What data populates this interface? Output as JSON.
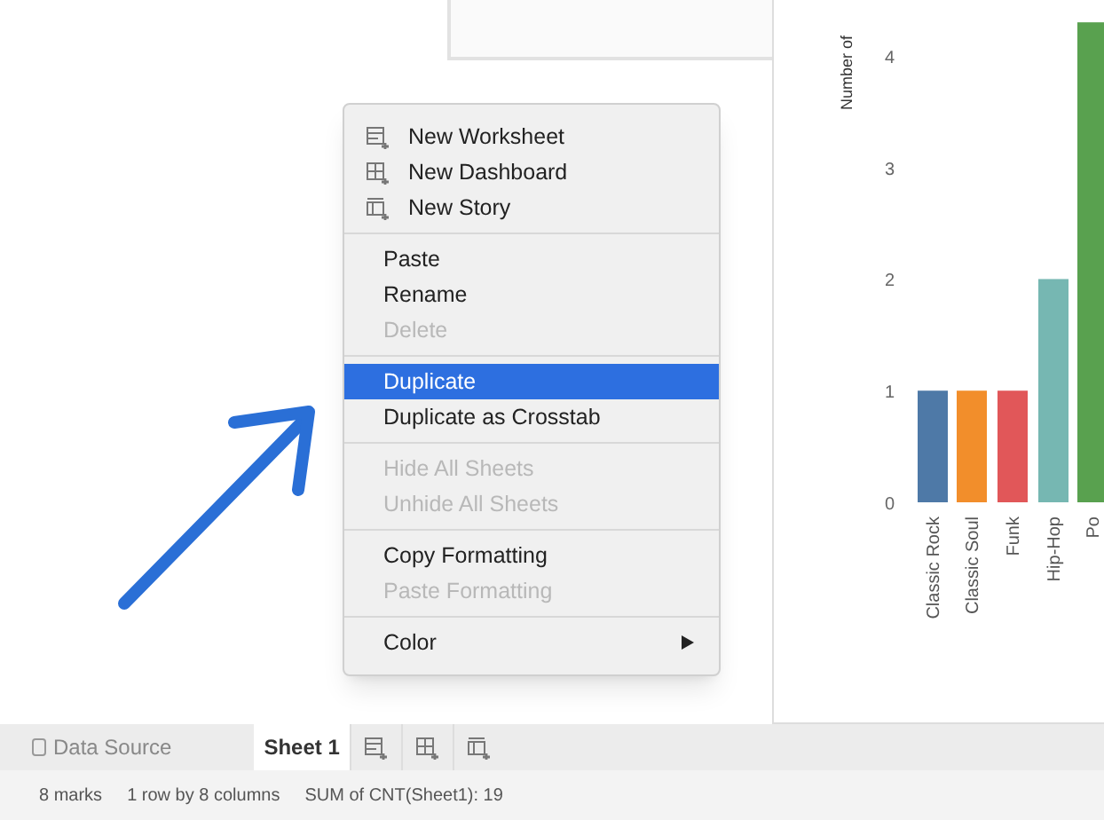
{
  "chart": {
    "chart_data": {
      "type": "bar",
      "ylabel": "Number of",
      "categories": [
        "Classic Rock",
        "Classic Soul",
        "Funk",
        "Hip-Hop",
        "Po"
      ],
      "values": [
        1,
        1,
        1,
        2,
        4.3
      ],
      "ylim": [
        0,
        4.5
      ],
      "yticks": [
        0,
        1,
        2,
        3,
        4
      ]
    }
  },
  "context_menu": {
    "sections": [
      [
        {
          "label": "New Worksheet",
          "kind": "worksheet",
          "disabled": false,
          "selected": false
        },
        {
          "label": "New Dashboard",
          "kind": "dashboard",
          "disabled": false,
          "selected": false
        },
        {
          "label": "New Story",
          "kind": "story",
          "disabled": false,
          "selected": false
        }
      ],
      [
        {
          "label": "Paste",
          "disabled": false,
          "selected": false
        },
        {
          "label": "Rename",
          "disabled": false,
          "selected": false
        },
        {
          "label": "Delete",
          "disabled": true,
          "selected": false
        }
      ],
      [
        {
          "label": "Duplicate",
          "disabled": false,
          "selected": true
        },
        {
          "label": "Duplicate as Crosstab",
          "disabled": false,
          "selected": false
        }
      ],
      [
        {
          "label": "Hide All Sheets",
          "disabled": true,
          "selected": false
        },
        {
          "label": "Unhide All Sheets",
          "disabled": true,
          "selected": false
        }
      ],
      [
        {
          "label": "Copy Formatting",
          "disabled": false,
          "selected": false
        },
        {
          "label": "Paste Formatting",
          "disabled": true,
          "selected": false
        }
      ],
      [
        {
          "label": "Color",
          "disabled": false,
          "selected": false,
          "submenu": true
        }
      ]
    ]
  },
  "tabs": [
    {
      "label": "Data Source",
      "kind": "datasource",
      "selected": false
    },
    {
      "label": "Sheet 1",
      "kind": "sheet",
      "selected": true
    },
    {
      "kind": "worksheet"
    },
    {
      "kind": "dashboard"
    },
    {
      "kind": "story"
    }
  ],
  "status_bar": [
    "8 marks",
    "1 row by 8 columns",
    "SUM of CNT(Sheet1): 19"
  ]
}
